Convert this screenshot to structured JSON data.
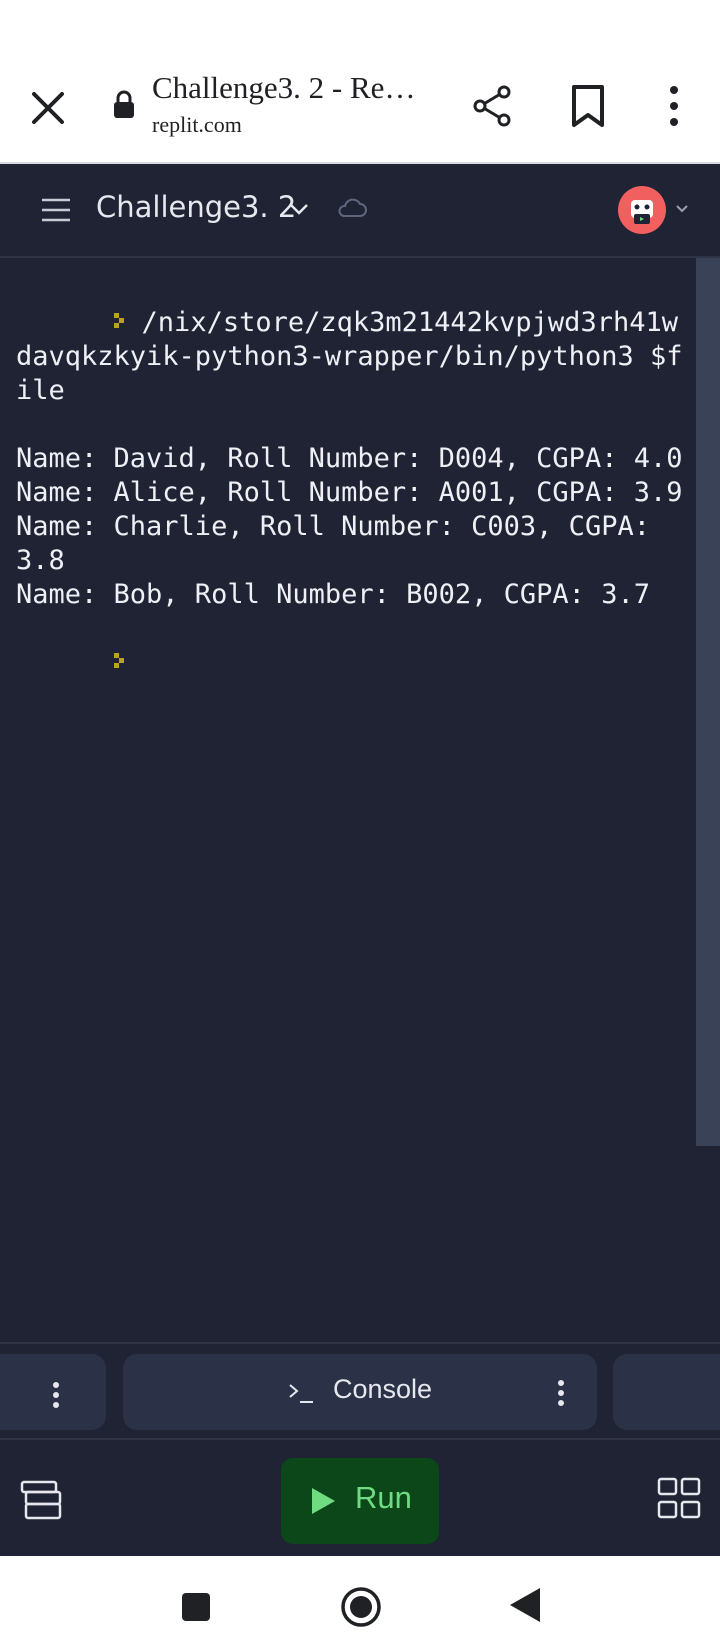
{
  "browser": {
    "title": "Challenge3. 2 - Re…",
    "url": "replit.com"
  },
  "repl": {
    "name": "Challenge3. 2"
  },
  "console": {
    "lines": [
      "/nix/store/zqk3m21442kvpjwd3rh41wdavqkzkyik-python3-wrapper/bin/python3 $file",
      "Name: David, Roll Number: D004, CGPA: 4.0",
      "Name: Alice, Roll Number: A001, CGPA: 3.9",
      "Name: Charlie, Roll Number: C003, CGPA: 3.8",
      "Name: Bob, Roll Number: B002, CGPA: 3.7"
    ],
    "prompt_color": "#b8a422"
  },
  "tabs": {
    "console_label": "Console"
  },
  "actions": {
    "run_label": "Run"
  },
  "colors": {
    "background": "#1f2333",
    "run_button": "#0b4719",
    "run_text": "#6fdc82",
    "avatar": "#f25f5f"
  }
}
